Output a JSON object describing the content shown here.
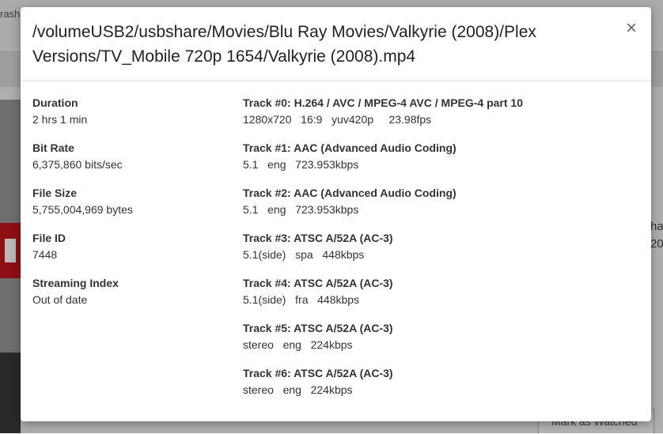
{
  "background": {
    "topbar_fragment": "rash",
    "right_text_1": "ha",
    "right_text_2": "20",
    "mark_button_label": "Mark as Watched"
  },
  "modal": {
    "title": "/volumeUSB2/usbshare/Movies/Blu Ray Movies/Valkyrie (2008)/Plex Versions/TV_Mobile 720p 1654/Valkyrie (2008).mp4",
    "close_label": "×",
    "info": [
      {
        "label": "Duration",
        "value": "2 hrs 1 min"
      },
      {
        "label": "Bit Rate",
        "value": "6,375,860 bits/sec"
      },
      {
        "label": "File Size",
        "value": "5,755,004,969 bytes"
      },
      {
        "label": "File ID",
        "value": "7448"
      },
      {
        "label": "Streaming Index",
        "value": "Out of date"
      }
    ],
    "tracks": [
      {
        "title": "Track #0: H.264 / AVC / MPEG-4 AVC / MPEG-4 part 10",
        "details": "1280x720   16:9   yuv420p     23.98fps"
      },
      {
        "title": "Track #1: AAC (Advanced Audio Coding)",
        "details": "5.1   eng   723.953kbps"
      },
      {
        "title": "Track #2: AAC (Advanced Audio Coding)",
        "details": "5.1   eng   723.953kbps"
      },
      {
        "title": "Track #3: ATSC A/52A (AC-3)",
        "details": "5.1(side)   spa   448kbps"
      },
      {
        "title": "Track #4: ATSC A/52A (AC-3)",
        "details": "5.1(side)   fra   448kbps"
      },
      {
        "title": "Track #5: ATSC A/52A (AC-3)",
        "details": "stereo   eng   224kbps"
      },
      {
        "title": "Track #6: ATSC A/52A (AC-3)",
        "details": "stereo   eng   224kbps"
      }
    ]
  }
}
